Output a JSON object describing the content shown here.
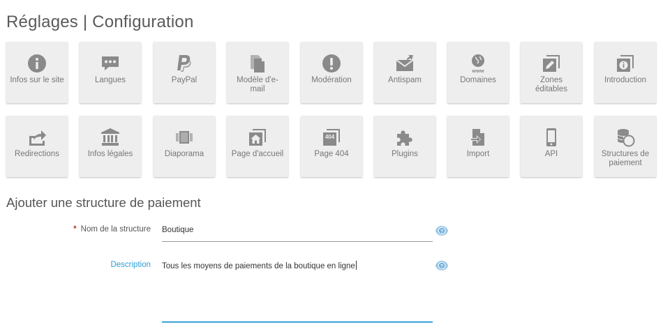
{
  "page_title": "Réglages | Configuration",
  "tiles_row1": [
    {
      "label": "Infos sur le site",
      "icon": "info-icon"
    },
    {
      "label": "Langues",
      "icon": "chat-icon"
    },
    {
      "label": "PayPal",
      "icon": "paypal-icon"
    },
    {
      "label": "Modèle d'e-mail",
      "icon": "documents-icon"
    },
    {
      "label": "Modération",
      "icon": "exclamation-icon"
    },
    {
      "label": "Antispam",
      "icon": "envelope-icon"
    },
    {
      "label": "Domaines",
      "icon": "globe-www-icon"
    },
    {
      "label": "Zones éditables",
      "icon": "edit-square-icon"
    },
    {
      "label": "Introduction",
      "icon": "info-stack-icon"
    }
  ],
  "tiles_row2": [
    {
      "label": "Redirections",
      "icon": "share-arrow-icon"
    },
    {
      "label": "Infos légales",
      "icon": "bank-icon"
    },
    {
      "label": "Diaporama",
      "icon": "slideshow-icon"
    },
    {
      "label": "Page d'accueil",
      "icon": "home-stack-icon"
    },
    {
      "label": "Page 404",
      "icon": "page-404-icon"
    },
    {
      "label": "Plugins",
      "icon": "puzzle-icon"
    },
    {
      "label": "Import",
      "icon": "import-icon"
    },
    {
      "label": "API",
      "icon": "phone-icon"
    },
    {
      "label": "Structures de paiement",
      "icon": "coins-icon"
    }
  ],
  "tile_404_text": "404",
  "tile_www_text": "www",
  "form": {
    "title": "Ajouter une structure de paiement",
    "required_mark": "*",
    "name_label": "Nom de la structure",
    "name_value": "Boutique",
    "description_label": "Description",
    "description_value": "Tous les moyens de paiements de la boutique en ligne"
  },
  "colors": {
    "tile_bg": "#eeeeee",
    "icon": "#8a8a8a",
    "accent": "#3aa3dc",
    "required": "#c0392b"
  }
}
